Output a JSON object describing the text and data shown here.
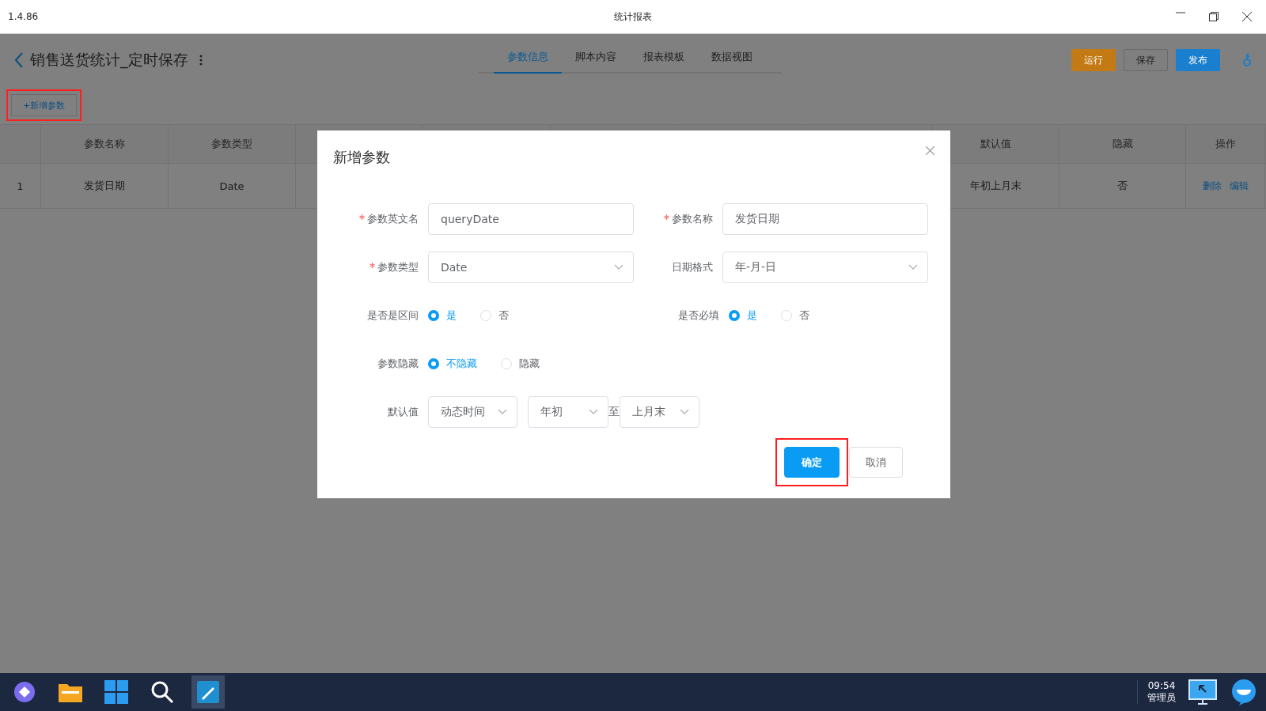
{
  "window": {
    "version": "1.4.86",
    "title": "统计报表"
  },
  "header": {
    "title": "销售送货统计_定时保存",
    "tabs": [
      {
        "label": "参数信息",
        "selected": true
      },
      {
        "label": "脚本内容",
        "selected": false
      },
      {
        "label": "报表模板",
        "selected": false
      },
      {
        "label": "数据视图",
        "selected": false
      }
    ],
    "buttons": [
      {
        "label": "运行",
        "kind": "run"
      },
      {
        "label": "保存",
        "kind": "save"
      },
      {
        "label": "发布",
        "kind": "publish"
      }
    ]
  },
  "add_button": {
    "label": "+新增参数",
    "highlighted": true
  },
  "table": {
    "columns_left": [
      "参数名称",
      "参数类型"
    ],
    "columns_right": [
      "默认值",
      "隐藏",
      "操作"
    ],
    "rows": [
      {
        "index": "1",
        "left": [
          "发货日期",
          "Date"
        ],
        "right": [
          "年初上月末",
          "否"
        ],
        "actions": [
          "删除",
          "编辑"
        ]
      }
    ]
  },
  "dialog": {
    "title": "新增参数",
    "rows": [
      [
        {
          "kind": "input",
          "label": "参数英文名",
          "required": true,
          "value": "queryDate"
        },
        {
          "kind": "input",
          "label": "参数名称",
          "required": true,
          "value": "发货日期"
        }
      ],
      [
        {
          "kind": "select",
          "label": "参数类型",
          "required": true,
          "value": "Date"
        },
        {
          "kind": "select",
          "label": "日期格式",
          "required": false,
          "value": "年-月-日"
        }
      ],
      [
        {
          "kind": "radio",
          "label": "是否是区间",
          "required": false,
          "options": [
            {
              "label": "是",
              "selected": true
            },
            {
              "label": "否",
              "selected": false
            }
          ]
        },
        {
          "kind": "radio",
          "label": "是否必填",
          "required": false,
          "options": [
            {
              "label": "是",
              "selected": true
            },
            {
              "label": "否",
              "selected": false
            }
          ]
        }
      ],
      [
        {
          "kind": "radio",
          "label": "参数隐藏",
          "required": false,
          "options": [
            {
              "label": "不隐藏",
              "selected": true
            },
            {
              "label": "隐藏",
              "selected": false
            }
          ]
        }
      ],
      [
        {
          "kind": "range",
          "label": "默认值",
          "required": false,
          "parts": [
            {
              "kind": "select",
              "value": "动态时间"
            },
            {
              "kind": "select",
              "value": "年初"
            },
            {
              "kind": "text",
              "value": "至"
            },
            {
              "kind": "select",
              "value": "上月末"
            }
          ]
        }
      ]
    ],
    "buttons": [
      {
        "label": "确定",
        "kind": "primary",
        "highlighted": true
      },
      {
        "label": "取消",
        "kind": "default",
        "highlighted": false
      }
    ]
  },
  "taskbar": {
    "time": "09:54",
    "user": "管理员"
  }
}
